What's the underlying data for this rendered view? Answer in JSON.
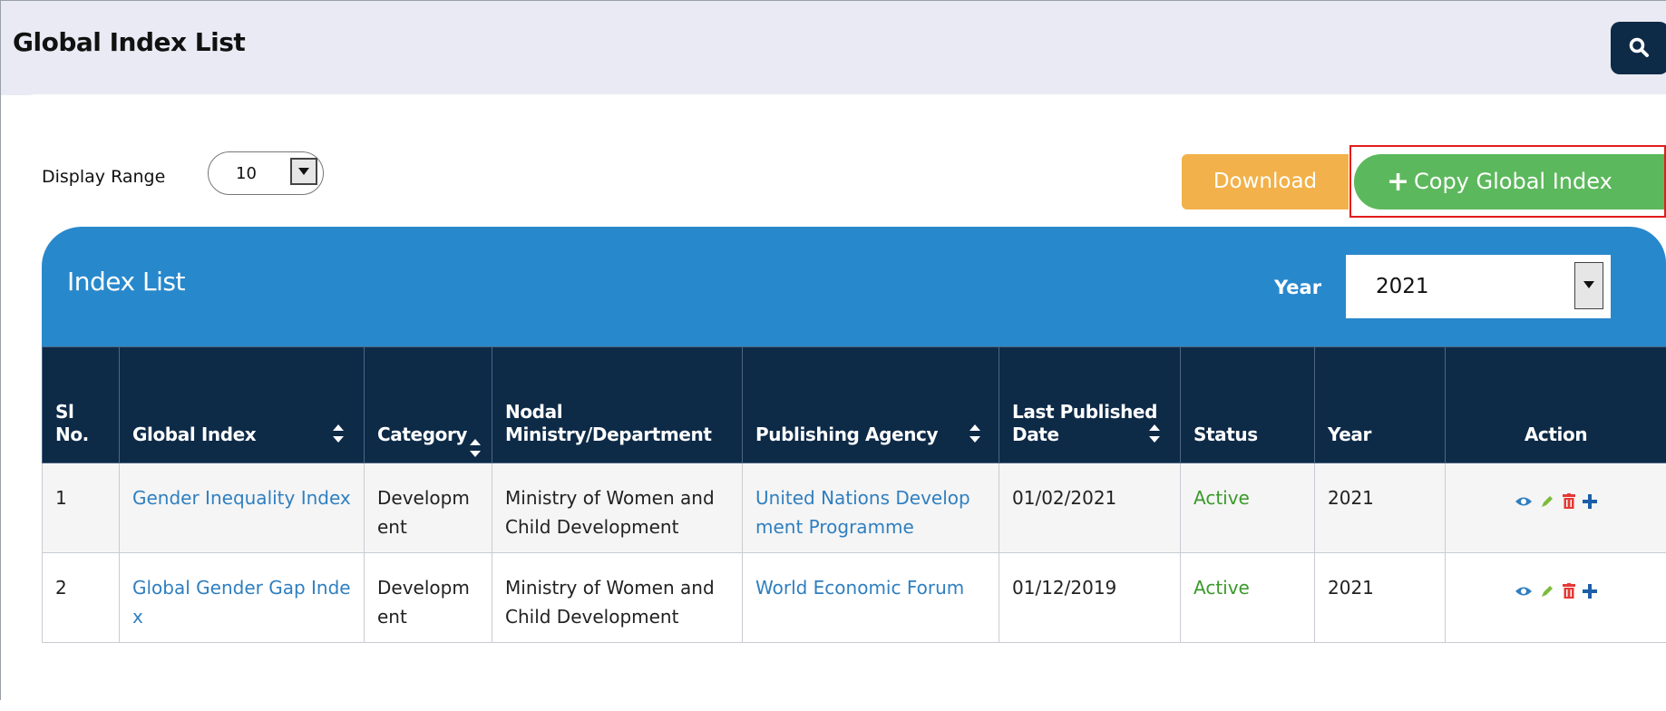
{
  "page": {
    "title": "Global Index List"
  },
  "toolbar": {
    "display_range_label": "Display Range",
    "display_range_value": "10",
    "download_label": "Download",
    "copy_label": "Copy Global Index"
  },
  "index_list": {
    "title": "Index List",
    "year_label": "Year",
    "year_value": "2021"
  },
  "table": {
    "headers": {
      "sl_no": "Sl No.",
      "global_index": "Global Index",
      "category": "Category",
      "nodal": "Nodal Ministry/Department",
      "agency": "Publishing Agency",
      "date": "Last Published Date",
      "status": "Status",
      "year": "Year",
      "action": "Action"
    },
    "rows": [
      {
        "sl": "1",
        "index": "Gender Inequality Index",
        "category": "Development",
        "nodal": "Ministry of Women and Child Development",
        "agency": "United Nations Development Programme",
        "date": "01/02/2021",
        "status": "Active",
        "year": "2021"
      },
      {
        "sl": "2",
        "index": "Global Gender Gap Index",
        "category": "Development",
        "nodal": "Ministry of Women and Child Development",
        "agency": "World Economic Forum",
        "date": "01/12/2019",
        "status": "Active",
        "year": "2021"
      }
    ]
  },
  "icons": {
    "search": "search-icon",
    "view": "eye-icon",
    "edit": "pencil-icon",
    "delete": "trash-icon",
    "add": "plus-icon"
  },
  "colors": {
    "navy": "#0d2a47",
    "blue": "#2888cc",
    "orange": "#f2b14a",
    "green": "#5cb85c",
    "link": "#2f7fc0",
    "active": "#3a9a2a"
  }
}
